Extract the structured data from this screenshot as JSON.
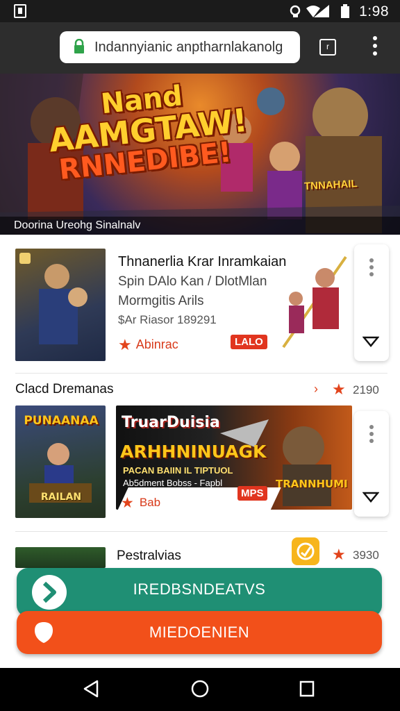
{
  "status_bar": {
    "time": "1:98"
  },
  "browser": {
    "url": "Indannyianic anptharnlakanolg"
  },
  "banner": {
    "title_line1": "Nand",
    "title_line2": "AAMGTAW!",
    "title_line3": "RNNEDIBE!",
    "badge": "TNNAHAIL",
    "caption": "Doorina Ureohg Sinalnalv"
  },
  "card1": {
    "title": "Thnanerlia Krar Inramkaian",
    "subtitle": "Spin DAlo Kan / DlotMlan",
    "genre": "Mormgitis Arils",
    "price": "$Ar Riasor 189291",
    "rating_label": "Abinrac",
    "badge": "LALO"
  },
  "section": {
    "name": "Clacd Dremanas",
    "rating": "2190"
  },
  "card2": {
    "thumb_title": "PUNAANAA",
    "thumb_sub": "RAILAN",
    "banner_title": "TruarDuisia",
    "banner_headline": "ARHHNINUAGK",
    "banner_line1": "PACAN BAIIN IL TIPTUOL",
    "banner_line2": "Ab5dment Bobss - Fapbl",
    "rating_label": "Bab",
    "badge": "MPS",
    "gold_label": "TRANNHUMI"
  },
  "card3": {
    "name": "Pestralvias",
    "rating": "3930"
  },
  "actions": {
    "primary": "IREDBSNDEATVS",
    "secondary": "MIEDOENIEN"
  },
  "colors": {
    "accent_green": "#1f8f74",
    "accent_orange": "#f2501a",
    "rating_red": "#e2441c"
  }
}
